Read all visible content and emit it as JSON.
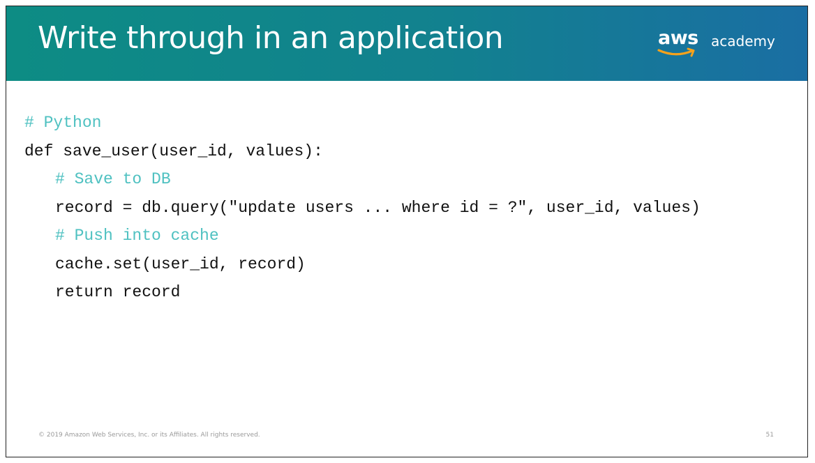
{
  "header": {
    "title": "Write through in an application",
    "logo_wordmark": "aws",
    "logo_suffix": "academy",
    "colors": {
      "gradient_start": "#0d8c84",
      "gradient_end": "#1a6ea3",
      "smile": "#f7a21b"
    }
  },
  "code": {
    "lines": [
      {
        "text": "# Python",
        "type": "comment",
        "indent": 0
      },
      {
        "text": "def save_user(user_id, values):",
        "type": "code",
        "indent": 0
      },
      {
        "text": "# Save to DB",
        "type": "comment",
        "indent": 1
      },
      {
        "text": "record = db.query(\"update users ... where id = ?\", user_id, values)",
        "type": "code",
        "indent": 1
      },
      {
        "text": "# Push into cache",
        "type": "comment",
        "indent": 1
      },
      {
        "text": "cache.set(user_id, record)",
        "type": "code",
        "indent": 1
      },
      {
        "text": "return record",
        "type": "code",
        "indent": 1
      }
    ],
    "comment_color": "#4fc1c1"
  },
  "footer": {
    "copyright": "© 2019 Amazon Web Services, Inc. or its Affiliates. All rights reserved.",
    "page_number": "51"
  }
}
